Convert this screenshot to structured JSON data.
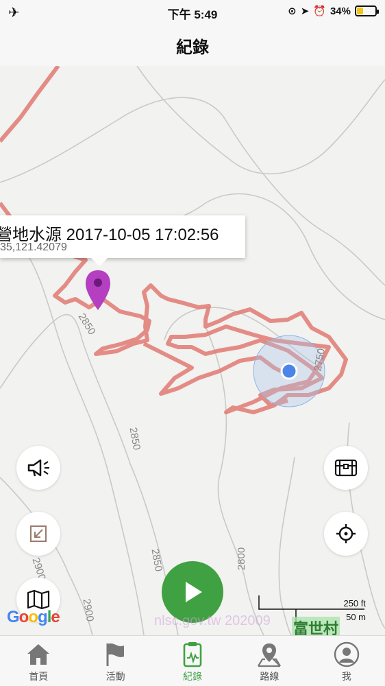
{
  "status_bar": {
    "time": "下午 5:49",
    "battery": "34%",
    "battery_level": 0.34,
    "battery_color": "#f2c318",
    "icons": [
      "airplane-icon",
      "orientation-lock-icon",
      "location-arrow-icon",
      "alarm-icon"
    ]
  },
  "header": {
    "title": "紀錄"
  },
  "map": {
    "callout": {
      "title": "營地水源 2017-10-05 17:02:56",
      "subtitle": "35,121.42079"
    },
    "contour_labels": [
      "2850",
      "2850",
      "2850",
      "2900",
      "2900",
      "2800",
      "2750"
    ],
    "scale": {
      "feet": "250 ft",
      "meters": "50 m"
    },
    "logo_text": "Google",
    "watermark": "nlsc.gov.tw 202009",
    "place_label": "富世村",
    "track_color": "#e07a72",
    "pin_color": "#b43fc0",
    "location_color": "#4a86e8"
  },
  "buttons": {
    "left": [
      "announce-icon",
      "collapse-arrow-icon",
      "map-icon"
    ],
    "right": [
      "treasure-chest-icon",
      "crosshair-icon"
    ],
    "play_color": "#3fa142"
  },
  "tabs": [
    {
      "label": "首頁",
      "icon": "home-icon",
      "active": false
    },
    {
      "label": "活動",
      "icon": "flag-icon",
      "active": false
    },
    {
      "label": "紀錄",
      "icon": "clipboard-icon",
      "active": true
    },
    {
      "label": "路線",
      "icon": "route-pin-icon",
      "active": false
    },
    {
      "label": "我",
      "icon": "profile-icon",
      "active": false
    }
  ]
}
